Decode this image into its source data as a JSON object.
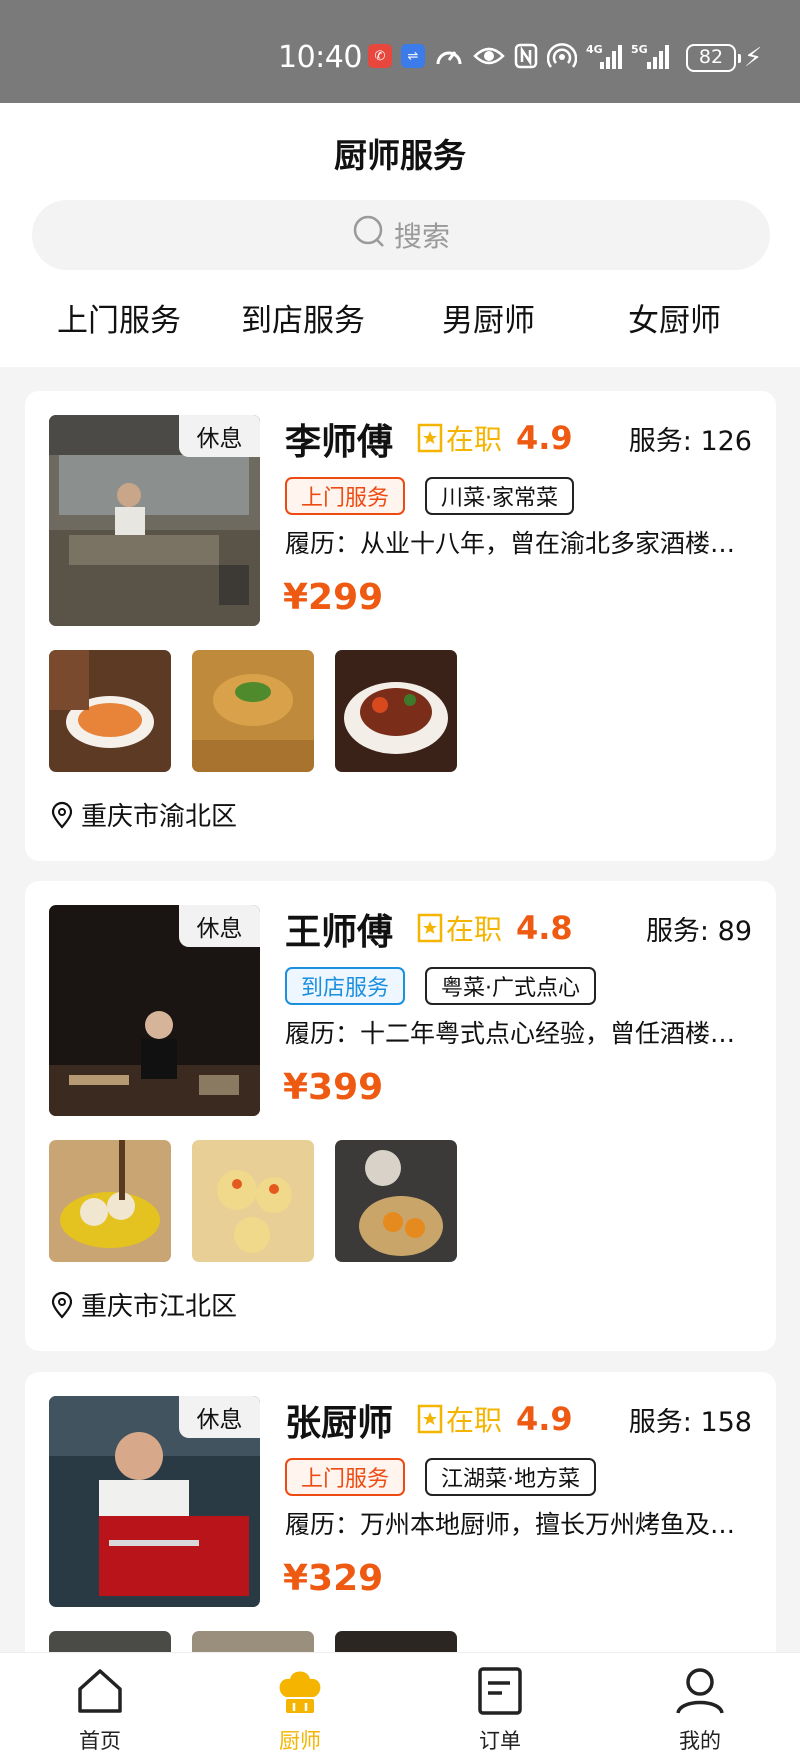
{
  "status_bar": {
    "time": "10:40",
    "battery": "82",
    "network_4g": "4G",
    "network_5g": "5G"
  },
  "header": {
    "title": "厨师服务",
    "search_placeholder": "搜索",
    "tabs": [
      "上门服务",
      "到店服务",
      "男厨师",
      "女厨师"
    ]
  },
  "chefs": [
    {
      "name": "李师傅",
      "rest_label": "休息",
      "status": "在职",
      "rating": "4.9",
      "service_label": "服务:",
      "service_count": "126",
      "service_type": "上门服务",
      "cuisine": "川菜·家常菜",
      "resume": "履历：从业十八年，曾在渝北多家酒楼担任主厨",
      "price": "¥299",
      "location": "重庆市渝北区"
    },
    {
      "name": "王师傅",
      "rest_label": "休息",
      "status": "在职",
      "rating": "4.8",
      "service_label": "服务:",
      "service_count": "89",
      "service_type": "到店服务",
      "cuisine": "粤菜·广式点心",
      "resume": "履历：十二年粤式点心经验，曾任酒楼点心主管",
      "price": "¥399",
      "location": "重庆市江北区"
    },
    {
      "name": "张厨师",
      "rest_label": "休息",
      "status": "在职",
      "rating": "4.9",
      "service_label": "服务:",
      "service_count": "158",
      "service_type": "上门服务",
      "cuisine": "江湖菜·地方菜",
      "resume": "履历：万州本地厨师，擅长万州烤鱼及江湖菜",
      "price": "¥329",
      "location": ""
    }
  ],
  "tab_bar": {
    "items": [
      {
        "label": "首页",
        "icon": "home-icon"
      },
      {
        "label": "厨师",
        "icon": "chef-hat-icon"
      },
      {
        "label": "订单",
        "icon": "order-icon"
      },
      {
        "label": "我的",
        "icon": "profile-icon"
      }
    ],
    "active_index": 1
  },
  "colors": {
    "accent": "#ee5a12",
    "active_tab": "#f5b400",
    "status_yellow": "#f5b400",
    "store_blue": "#1b8fe0"
  }
}
